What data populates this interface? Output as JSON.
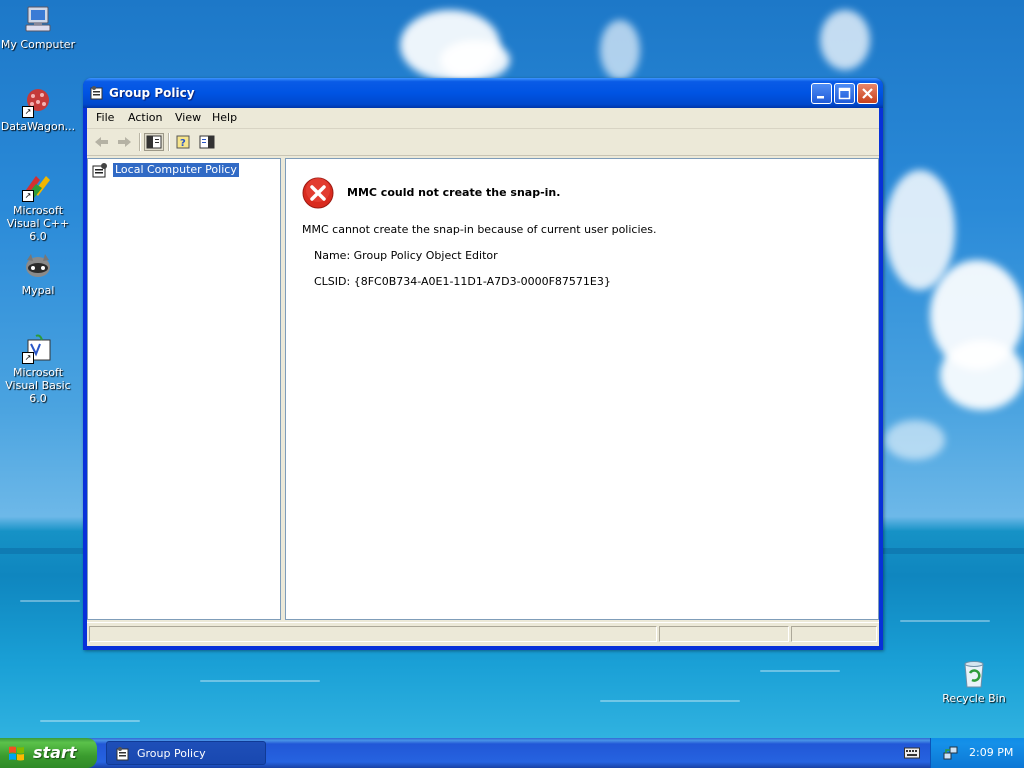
{
  "desktop": {
    "icons": [
      {
        "label": "My Computer",
        "icon": "computer-icon"
      },
      {
        "label": "DataWagon...",
        "icon": "datawagon-icon"
      },
      {
        "label": "Microsoft Visual C++ 6.0",
        "icon": "visual-cpp-icon"
      },
      {
        "label": "Mypal",
        "icon": "mypal-icon"
      },
      {
        "label": "Microsoft Visual Basic 6.0",
        "icon": "visual-basic-icon"
      },
      {
        "label": "Recycle Bin",
        "icon": "recycle-bin-icon"
      }
    ]
  },
  "window": {
    "title": "Group Policy",
    "menu": [
      "File",
      "Action",
      "View",
      "Help"
    ],
    "tree": {
      "items": [
        {
          "label": "Local Computer Policy",
          "selected": true
        }
      ]
    },
    "content": {
      "error_title": "MMC could not create the snap-in.",
      "message": "MMC cannot create the snap-in because of current user policies.",
      "name_line": "Name: Group Policy Object Editor",
      "clsid_line": "CLSID: {8FC0B734-A0E1-11D1-A7D3-0000F87571E3}"
    }
  },
  "taskbar": {
    "start_label": "start",
    "task_label": "Group Policy",
    "clock": "2:09 PM"
  },
  "colors": {
    "selection": "#316ac5",
    "titlebar": "#0054e3",
    "start_green": "#3a9b2e"
  }
}
